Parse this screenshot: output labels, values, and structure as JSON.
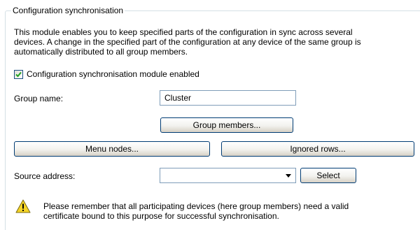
{
  "section": {
    "title": "Configuration synchronisation",
    "description_lines": [
      "This module enables you to keep specified parts of the configuration in sync across several",
      "devices. A change in the specified part of the configuration at any device of the same group is",
      "automatically distributed to all group members."
    ]
  },
  "module_enabled": {
    "label": "Configuration synchronisation module enabled",
    "checked": true
  },
  "group_name": {
    "label": "Group name:",
    "value": "Cluster"
  },
  "buttons": {
    "group_members": "Group members...",
    "menu_nodes": "Menu nodes...",
    "ignored_rows": "Ignored rows...",
    "select": "Select"
  },
  "source_address": {
    "label": "Source address:",
    "value": ""
  },
  "warning": {
    "icon": "warning-triangle-icon",
    "lines": [
      "Please remember that all participating devices (here group members) need a valid",
      "certificate bound to this purpose for successful synchronisation."
    ]
  },
  "colors": {
    "groupbox_border": "#d5dfe5",
    "button_border": "#003c74",
    "field_border": "#7f9db9",
    "checkbox_border": "#1c5180",
    "warning_fill": "#f5d426"
  }
}
